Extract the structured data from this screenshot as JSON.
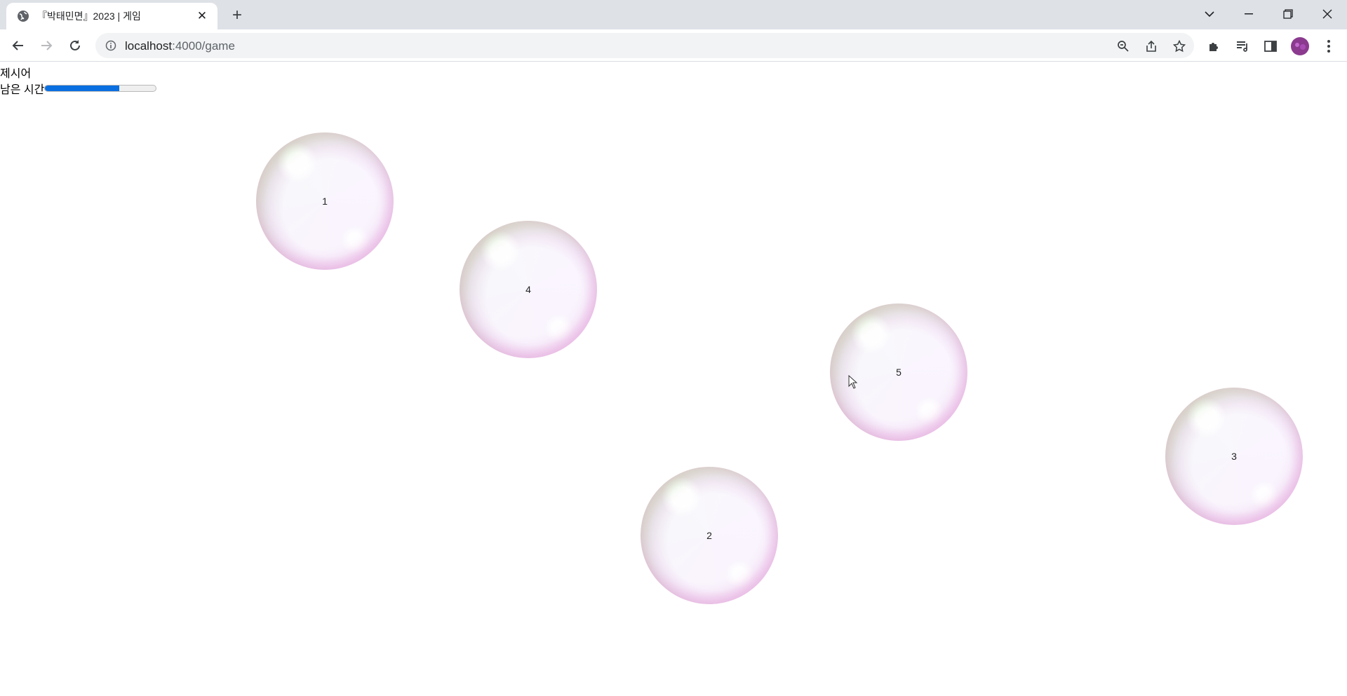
{
  "browser": {
    "tab": {
      "title": "『박태민면』2023 | 게임",
      "favicon": "globe-icon"
    },
    "address": {
      "host": "localhost",
      "path": ":4000/game"
    },
    "toolbar_icons": [
      "zoom-icon",
      "share-icon",
      "bookmark-star-icon",
      "extensions-icon",
      "reading-list-icon",
      "side-panel-icon",
      "profile-avatar",
      "menu-icon"
    ]
  },
  "game": {
    "prompt_label": "제시어",
    "timer_label": "남은 시간",
    "time_remaining_fraction": 0.67,
    "progress_color": "#0a6fe0",
    "bubbles": [
      {
        "label": "1"
      },
      {
        "label": "4"
      },
      {
        "label": "5"
      },
      {
        "label": "3"
      },
      {
        "label": "2"
      }
    ]
  }
}
